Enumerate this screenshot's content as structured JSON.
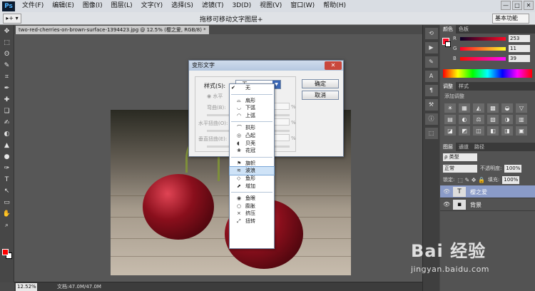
{
  "menubar": {
    "logo": "Ps",
    "items": [
      "文件(F)",
      "编辑(E)",
      "图像(I)",
      "图层(L)",
      "文字(Y)",
      "选择(S)",
      "滤镜(T)",
      "3D(D)",
      "视图(V)",
      "窗口(W)",
      "帮助(H)"
    ],
    "window_controls": [
      "—",
      "□",
      "✕"
    ]
  },
  "options_bar": {
    "tool_preset": "▸+ ▾",
    "title": "拖移可移动文字图层+",
    "workspace": "基本功能"
  },
  "document": {
    "tab_label": "two-red-cherries-on-brown-surface-1394423.jpg @ 12.5% (樱之爱, RGB/8) *",
    "zoom": "12.52%",
    "doc_info": "文档:47.0M/47.0M"
  },
  "toolbox": {
    "tools": [
      "✥",
      "⬚",
      "ʘ",
      "✎",
      "⌗",
      "✒",
      "✚",
      "❏",
      "✍",
      "◐",
      "▲",
      "●",
      "✑",
      "T",
      "↖",
      "▭",
      "✋",
      "⌕"
    ],
    "foreground_color": "#ff0000",
    "background_color": "#ffffff"
  },
  "color_panel": {
    "tabs": [
      "颜色",
      "色板"
    ],
    "channels": [
      {
        "label": "R",
        "value": "253"
      },
      {
        "label": "G",
        "value": "11"
      },
      {
        "label": "B",
        "value": "39"
      }
    ]
  },
  "adjustments_panel": {
    "tabs": [
      "调整",
      "样式"
    ],
    "title": "添加调整",
    "icons": [
      "☀",
      "▦",
      "◭",
      "▩",
      "◒",
      "▽",
      "▤",
      "◐",
      "⚖",
      "▧",
      "◑",
      "▥",
      "◪",
      "◩",
      "◫",
      "◧",
      "◨",
      "▣"
    ]
  },
  "layers_panel": {
    "tabs": [
      "图层",
      "通道",
      "路径"
    ],
    "filter": "ρ 类型",
    "blend_mode": "正常",
    "opacity_label": "不透明度:",
    "opacity": "100%",
    "lock_label": "锁定:",
    "fill_label": "填充:",
    "fill": "100%",
    "layers": [
      {
        "thumb": "T",
        "name": "樱之爱",
        "selected": true
      },
      {
        "thumb": "▪",
        "name": "背景",
        "selected": false
      }
    ]
  },
  "warp_dialog": {
    "title": "变形文字",
    "close": "✕",
    "style_label": "样式(S):",
    "style_value": "无",
    "orientation": "水平",
    "bend_label": "弯曲(B):",
    "h_distort_label": "水平扭曲(O):",
    "v_distort_label": "垂直扭曲(E):",
    "pct": "%",
    "ok": "确定",
    "cancel": "取消"
  },
  "style_dropdown": {
    "items": [
      {
        "icon": "",
        "label": "无",
        "checked": true,
        "group": 0
      },
      {
        "icon": "⌓",
        "label": "扇形",
        "group": 1
      },
      {
        "icon": "◡",
        "label": "下弧",
        "group": 1
      },
      {
        "icon": "◠",
        "label": "上弧",
        "group": 1
      },
      {
        "icon": "⌒",
        "label": "拱形",
        "group": 2
      },
      {
        "icon": "◎",
        "label": "凸起",
        "group": 2
      },
      {
        "icon": "◖",
        "label": "贝壳",
        "group": 2
      },
      {
        "icon": "❀",
        "label": "花冠",
        "group": 2
      },
      {
        "icon": "⚑",
        "label": "旗帜",
        "group": 3
      },
      {
        "icon": "≋",
        "label": "波浪",
        "active": true,
        "group": 3
      },
      {
        "icon": "◇",
        "label": "鱼形",
        "group": 3
      },
      {
        "icon": "⬈",
        "label": "增加",
        "group": 3
      },
      {
        "icon": "◉",
        "label": "鱼眼",
        "group": 4
      },
      {
        "icon": "○",
        "label": "膨胀",
        "group": 4
      },
      {
        "icon": "⨯",
        "label": "挤压",
        "group": 4
      },
      {
        "icon": "⤢",
        "label": "扭转",
        "group": 4
      }
    ]
  },
  "watermark": {
    "logo": "Bai 经验",
    "url": "jingyan.baidu.com"
  }
}
